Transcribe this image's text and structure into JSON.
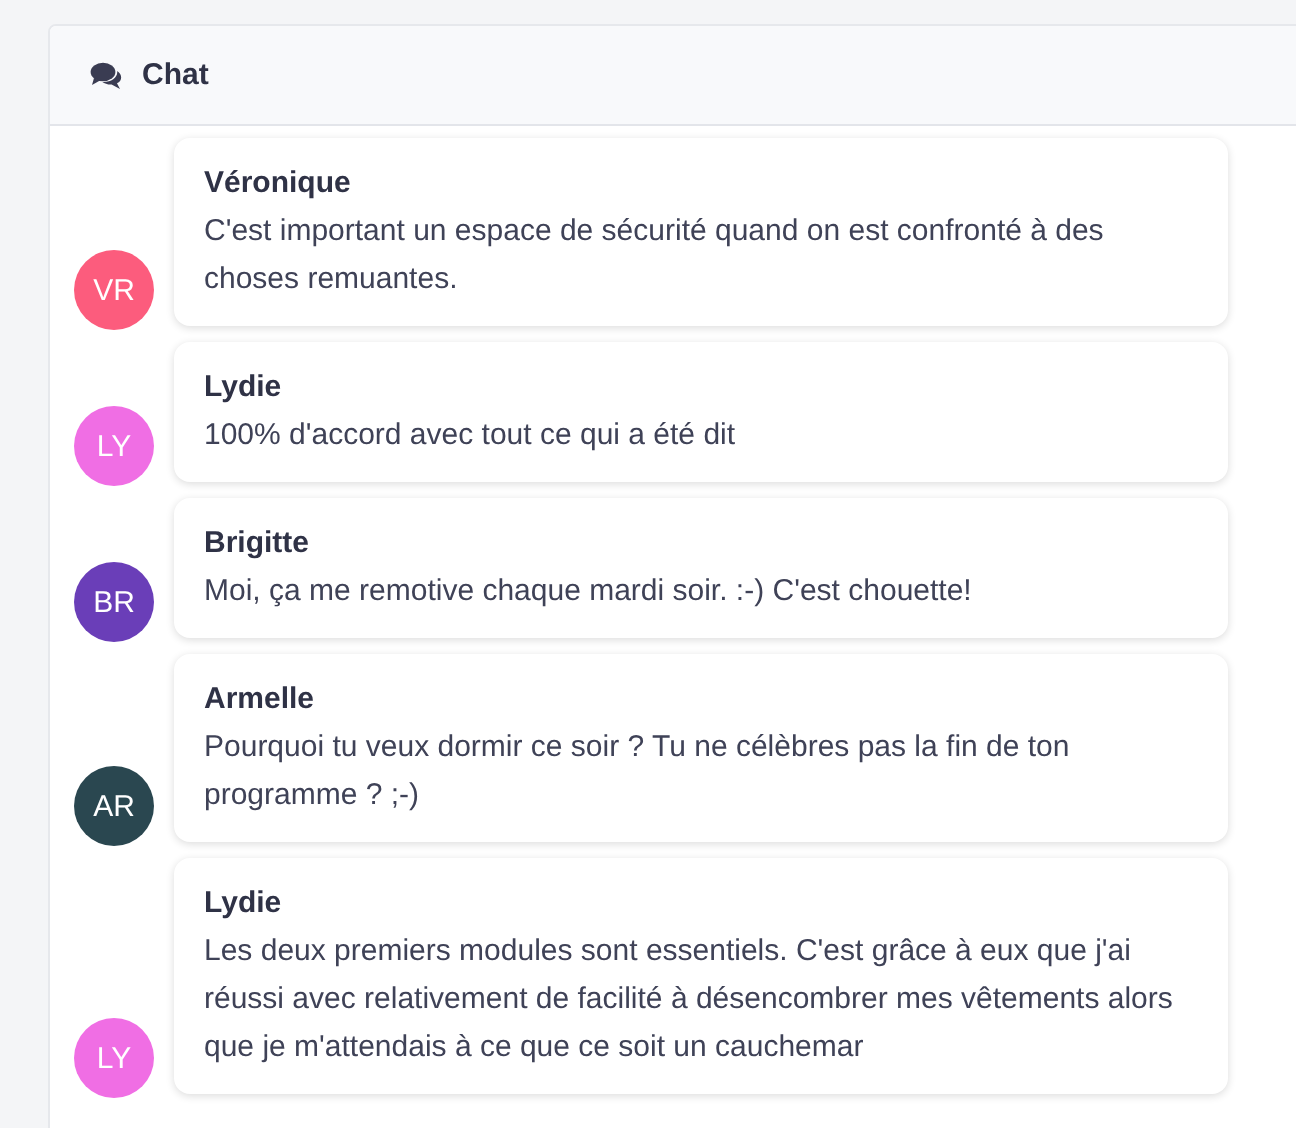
{
  "panel": {
    "title": "Chat"
  },
  "messages": [
    {
      "initials": "VR",
      "color": "#fc5c7d",
      "author": "Véronique",
      "text": "C'est important un espace de sécurité quand on est confronté à des choses remuantes."
    },
    {
      "initials": "LY",
      "color": "#f06ee4",
      "author": "Lydie",
      "text": "100% d'accord avec tout ce qui a été dit"
    },
    {
      "initials": "BR",
      "color": "#6a3eb8",
      "author": "Brigitte",
      "text": "Moi, ça me remotive chaque mardi soir. :-) C'est chouette!"
    },
    {
      "initials": "AR",
      "color": "#2a4750",
      "author": "Armelle",
      "text": "Pourquoi tu veux dormir ce soir ? Tu ne célèbres pas la fin de ton programme ? ;-)"
    },
    {
      "initials": "LY",
      "color": "#f06ee4",
      "author": "Lydie",
      "text": "Les deux premiers modules sont essentiels. C'est grâce à eux que j'ai réussi avec relativement de facilité à désencombrer mes vêtements alors que je m'attendais à ce que ce soit un cauchemar"
    }
  ]
}
